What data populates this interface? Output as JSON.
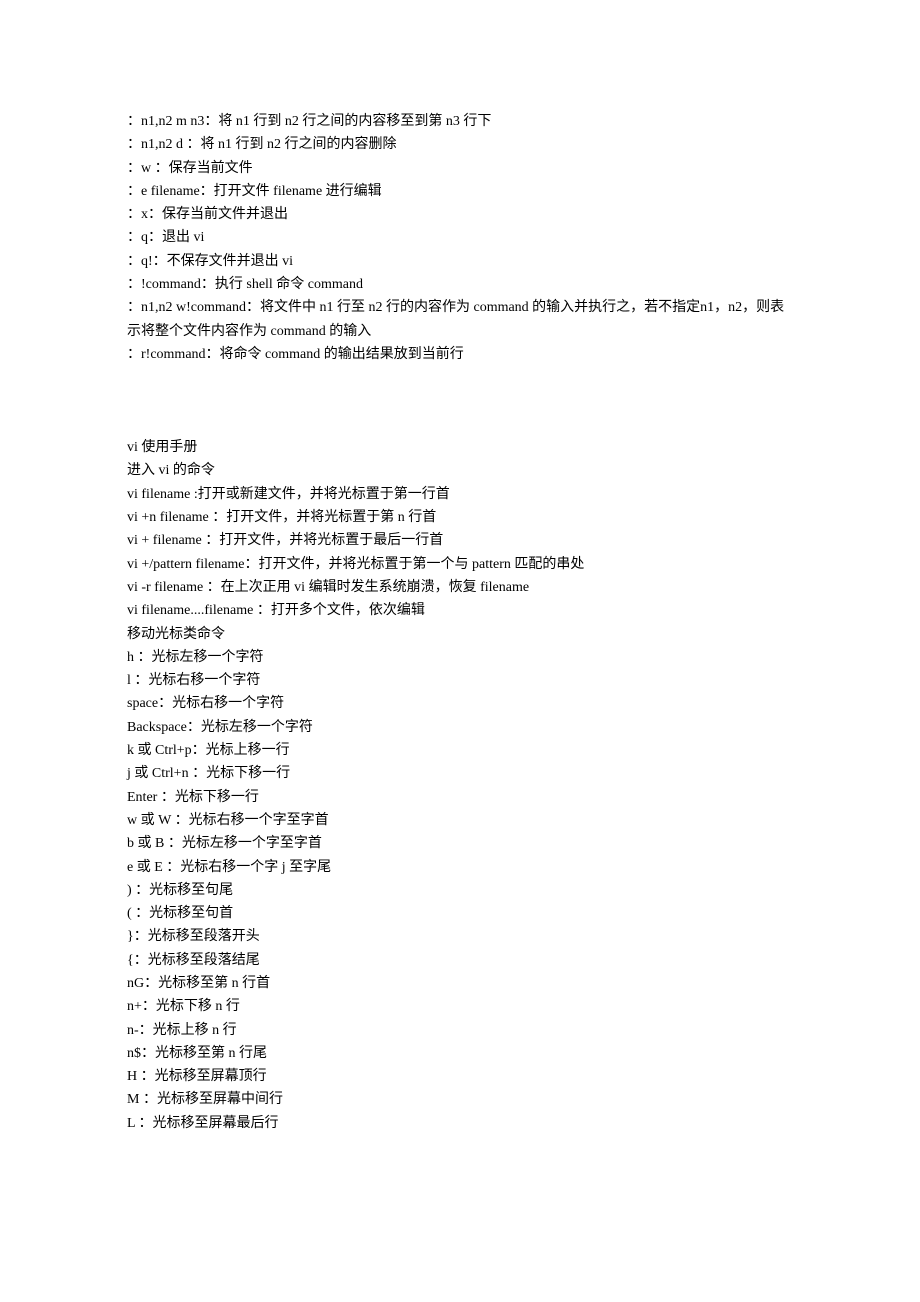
{
  "lines": [
    "：n1,n2 m n3：将 n1 行到 n2 行之间的内容移至到第 n3 行下",
    "：n1,n2 d ：将 n1 行到 n2 行之间的内容删除",
    "：w ：保存当前文件",
    "：e filename：打开文件 filename 进行编辑",
    "：x：保存当前文件并退出",
    "：q：退出 vi",
    "：q!：不保存文件并退出 vi",
    "：!command：执行 shell 命令 command",
    "：n1,n2 w!command：将文件中 n1 行至 n2 行的内容作为 command 的输入并执行之，若不指定n1，n2，则表示将整个文件内容作为 command 的输入",
    "：r!command：将命令 command 的输出结果放到当前行",
    "",
    "",
    "",
    "vi 使用手册",
    "进入 vi 的命令",
    "vi filename :打开或新建文件，并将光标置于第一行首",
    "vi +n filename ：打开文件，并将光标置于第 n 行首",
    "vi + filename ：打开文件，并将光标置于最后一行首",
    "vi +/pattern filename：打开文件，并将光标置于第一个与 pattern 匹配的串处",
    "vi -r filename ：在上次正用 vi 编辑时发生系统崩溃，恢复 filename",
    "vi filename....filename ：打开多个文件，依次编辑",
    "移动光标类命令",
    "h ：光标左移一个字符",
    "l ：光标右移一个字符",
    "space：光标右移一个字符",
    "Backspace：光标左移一个字符",
    "k 或 Ctrl+p：光标上移一行",
    "j 或 Ctrl+n ：光标下移一行",
    "Enter ：光标下移一行",
    "w 或 W ：光标右移一个字至字首",
    "b 或 B ：光标左移一个字至字首",
    "e 或 E ：光标右移一个字 j 至字尾",
    ") ：光标移至句尾",
    "( ：光标移至句首",
    "}：光标移至段落开头",
    "{：光标移至段落结尾",
    "nG：光标移至第 n 行首",
    "n+：光标下移 n 行",
    "n-：光标上移 n 行",
    "n$：光标移至第 n 行尾",
    "H ：光标移至屏幕顶行",
    "M ：光标移至屏幕中间行",
    "L ：光标移至屏幕最后行"
  ]
}
